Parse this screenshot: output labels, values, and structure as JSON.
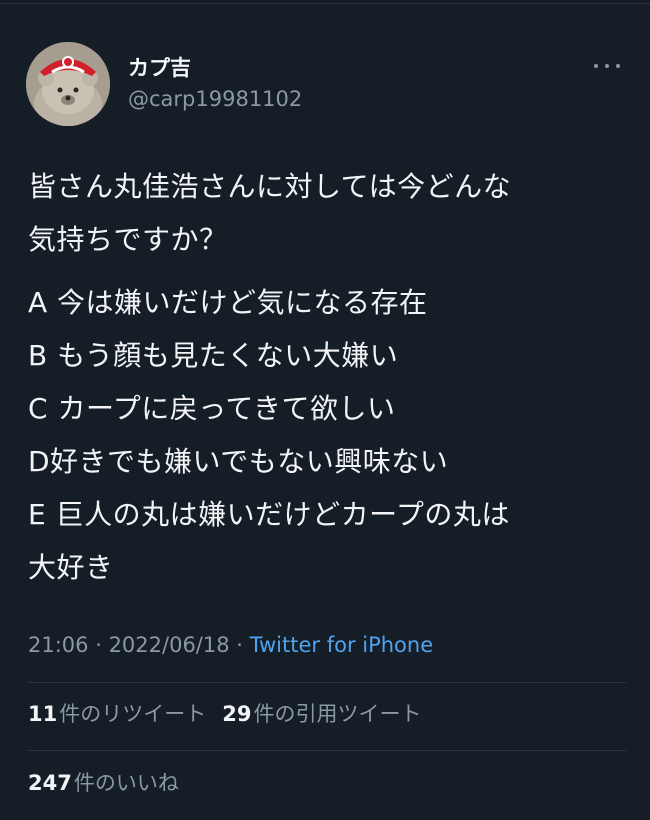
{
  "author": {
    "display_name": "カプ吉",
    "handle": "@carp19981102",
    "avatar_icon": "teddy-bear-avatar",
    "cap_color": "#d1202b"
  },
  "tweet": {
    "lines_q": [
      "皆さん丸佳浩さんに対しては今どんな",
      "気持ちですか？"
    ],
    "lines_opts": [
      "A 今は嫌いだけど気になる存在",
      "B もう顔も見たくない大嫌い",
      "C カープに戻ってきて欲しい",
      "D好きでも嫌いでもない興味ない",
      "E 巨人の丸は嫌いだけどカープの丸は",
      "大好き"
    ]
  },
  "meta": {
    "time": "21:06",
    "sep1": " · ",
    "date": "2022/06/18",
    "sep2": " · ",
    "source": "Twitter for iPhone"
  },
  "stats": {
    "retweets_count": "11",
    "retweets_label": "件のリツイート",
    "quotes_count": "29",
    "quotes_label": "件の引用ツイート",
    "likes_count": "247",
    "likes_label": "件のいいね"
  },
  "colors": {
    "background": "#151d27",
    "secondary_text": "#8b98a5",
    "link": "#4fa3ee"
  }
}
